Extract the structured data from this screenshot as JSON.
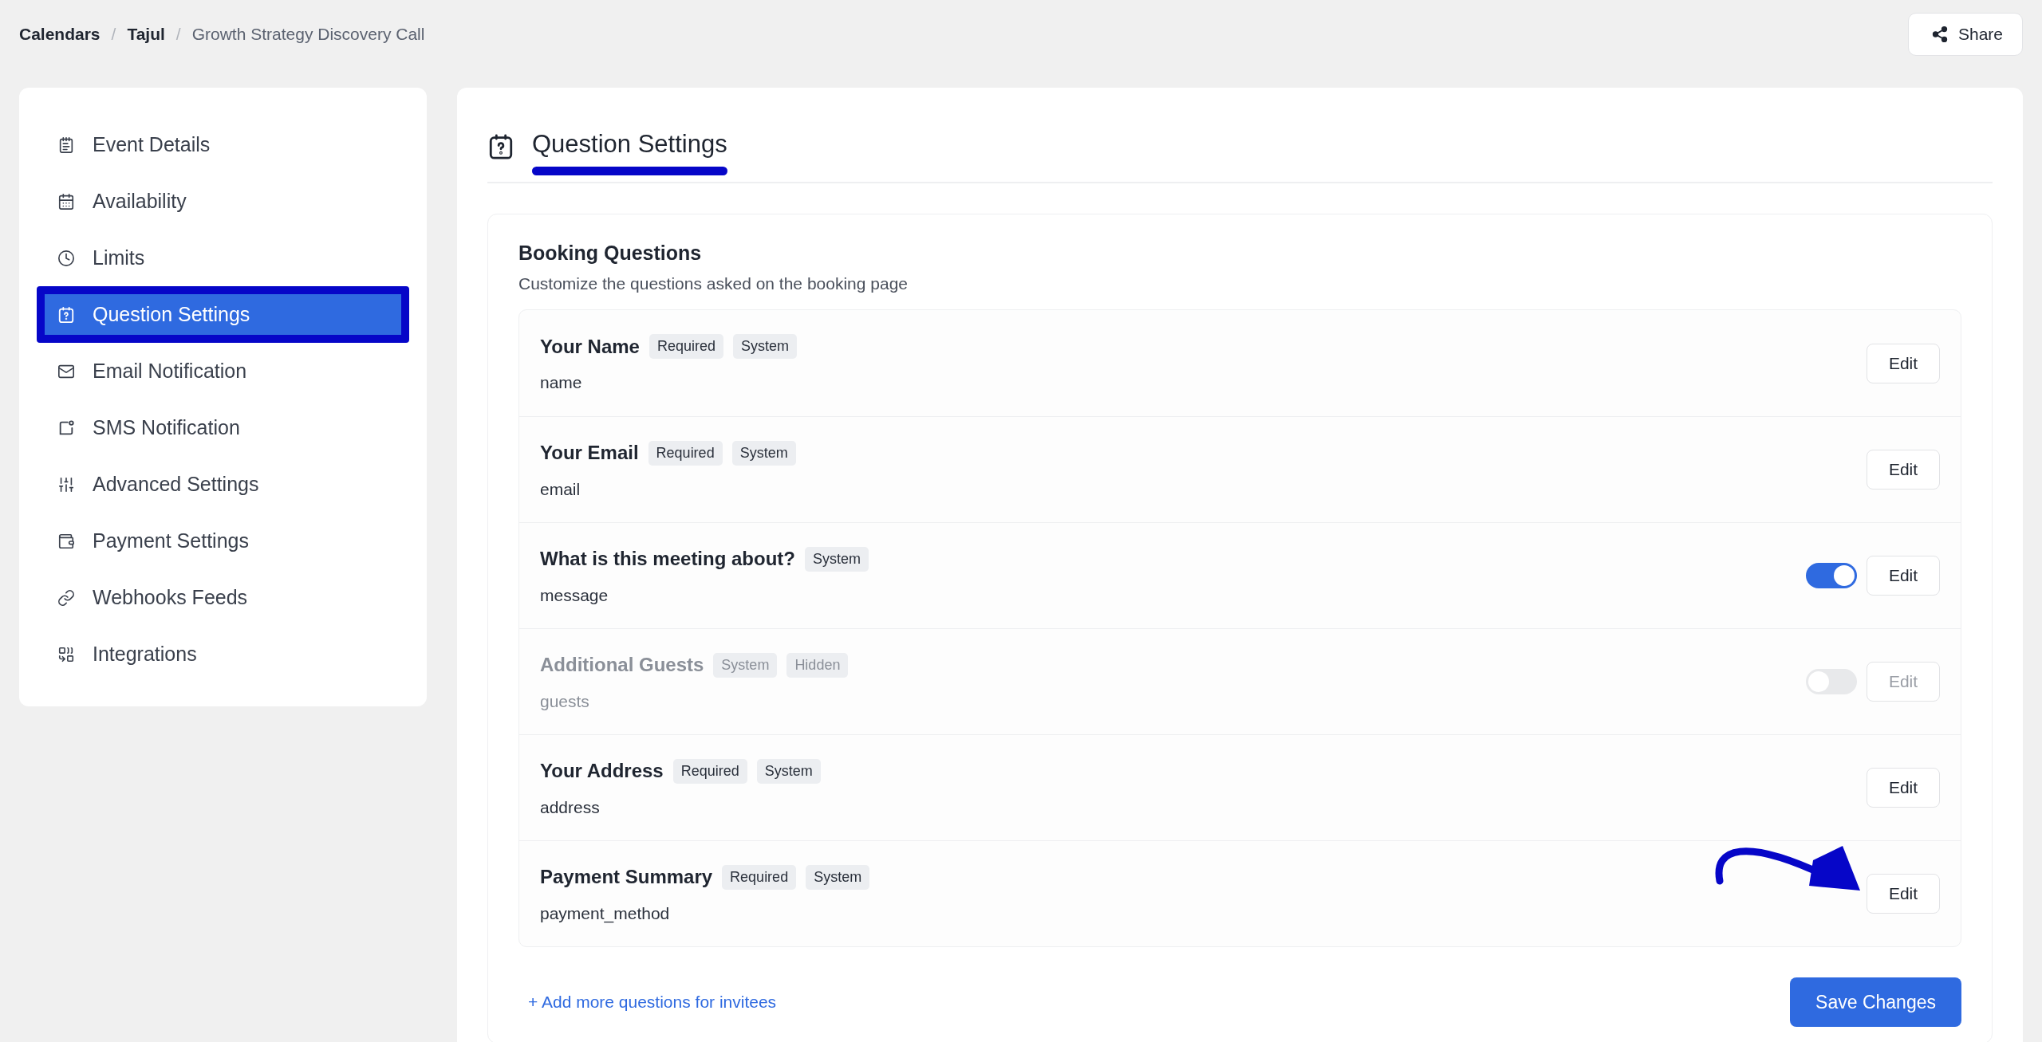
{
  "breadcrumb": [
    {
      "label": "Calendars",
      "current": false
    },
    {
      "label": "Tajul",
      "current": false,
      "separator": "/"
    },
    {
      "label": "Growth Strategy Discovery Call",
      "current": true,
      "separator": "/"
    }
  ],
  "share_button": {
    "label": "Share"
  },
  "sidebar": {
    "items": [
      {
        "label": "Event Details",
        "selected": false
      },
      {
        "label": "Availability",
        "selected": false
      },
      {
        "label": "Limits",
        "selected": false
      },
      {
        "label": "Question Settings",
        "selected": true
      },
      {
        "label": "Email Notification",
        "selected": false
      },
      {
        "label": "SMS Notification",
        "selected": false
      },
      {
        "label": "Advanced Settings",
        "selected": false
      },
      {
        "label": "Payment Settings",
        "selected": false
      },
      {
        "label": "Webhooks Feeds",
        "selected": false
      },
      {
        "label": "Integrations",
        "selected": false
      }
    ]
  },
  "page_title": "Question Settings",
  "booking_questions": {
    "title": "Booking Questions",
    "subtitle": "Customize the questions asked on the booking page",
    "questions": [
      {
        "label": "Your Name",
        "badges": [
          "Required",
          "System"
        ],
        "field": "name",
        "disabled": false,
        "edit": "Edit"
      },
      {
        "label": "Your Email",
        "badges": [
          "Required",
          "System"
        ],
        "field": "email",
        "disabled": false,
        "edit": "Edit"
      },
      {
        "label": "What is this meeting about?",
        "badges": [
          "System"
        ],
        "field": "message",
        "disabled": false,
        "toggle": {
          "on": true
        },
        "edit": "Edit"
      },
      {
        "label": "Additional Guests",
        "badges": [
          "System",
          "Hidden"
        ],
        "field": "guests",
        "disabled": true,
        "toggle": {
          "on": false
        },
        "edit": "Edit"
      },
      {
        "label": "Your Address",
        "badges": [
          "Required",
          "System"
        ],
        "field": "address",
        "disabled": false,
        "edit": "Edit"
      },
      {
        "label": "Payment Summary",
        "badges": [
          "Required",
          "System"
        ],
        "field": "payment_method",
        "disabled": false,
        "edit": "Edit",
        "annotated": true
      }
    ],
    "add_link": "+ Add more questions for invitees",
    "save_button": "Save Changes"
  }
}
